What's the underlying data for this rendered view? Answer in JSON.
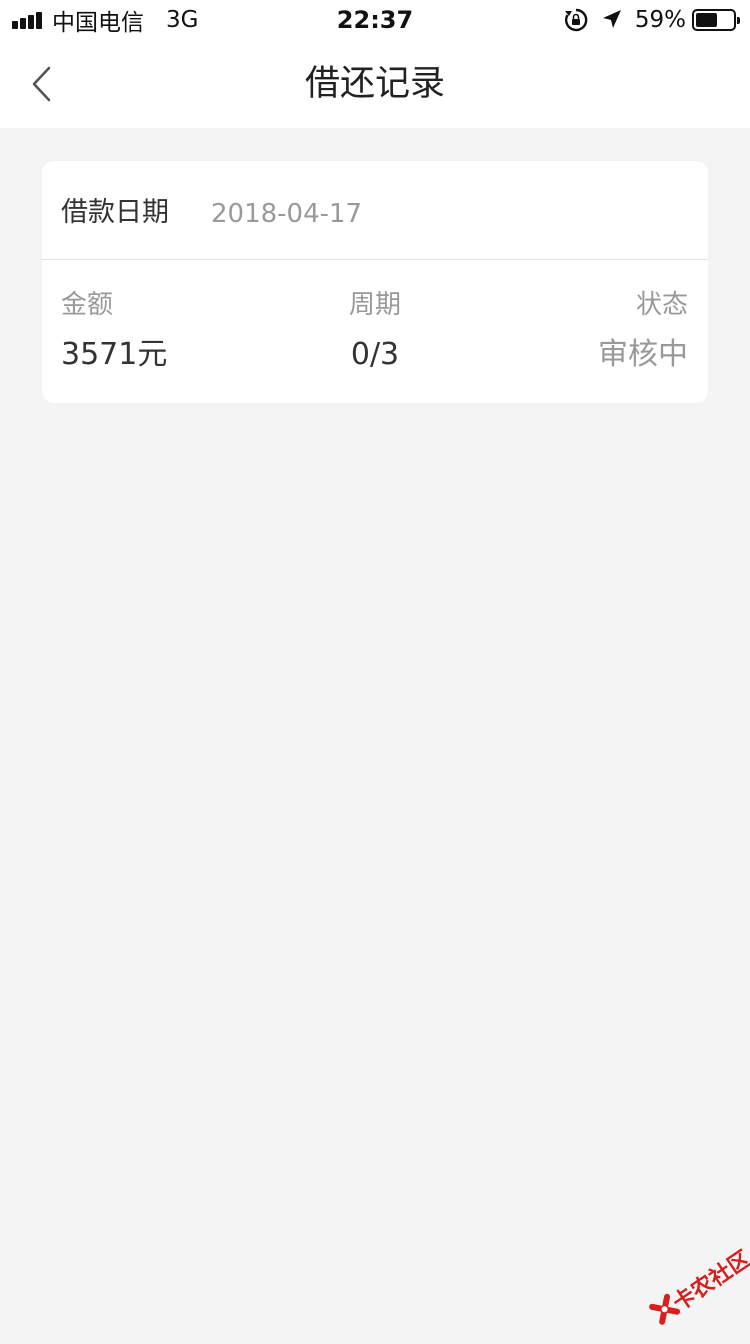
{
  "status_bar": {
    "carrier": "中国电信",
    "network": "3G",
    "time": "22:37",
    "battery_percent_text": "59%",
    "battery_level": 0.59,
    "signal_bars": 4,
    "icons": [
      "orientation-lock-icon",
      "location-arrow-icon",
      "battery-icon"
    ]
  },
  "nav": {
    "title": "借还记录",
    "back_icon": "chevron-left-icon"
  },
  "record": {
    "date_label": "借款日期",
    "date_value": "2018-04-17",
    "amount_label": "金额",
    "amount_value": "3571元",
    "period_label": "周期",
    "period_value": "0/3",
    "status_label": "状态",
    "status_value": "审核中"
  },
  "watermark": {
    "text": "卡农社区"
  },
  "colors": {
    "background": "#f4f4f4",
    "card": "#ffffff",
    "primary_text": "#333333",
    "secondary_text": "#999999",
    "watermark_red": "#d62020"
  }
}
